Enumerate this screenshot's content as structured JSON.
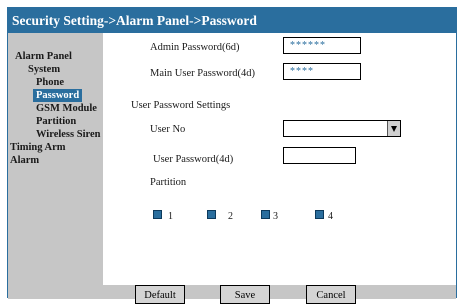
{
  "title": "Security Setting->Alarm Panel->Password",
  "sidebar": {
    "items": [
      {
        "label": "Alarm Panel"
      },
      {
        "label": "System"
      },
      {
        "label": "Phone"
      },
      {
        "label": "Password"
      },
      {
        "label": "GSM Module"
      },
      {
        "label": "Partition"
      },
      {
        "label": "Wireless Siren"
      },
      {
        "label": "Timing Arm"
      },
      {
        "label": "Alarm"
      }
    ],
    "selected": "Password"
  },
  "form": {
    "admin_password_label": "Admin Password(6d)",
    "admin_password_value": "******",
    "main_user_password_label": "Main User Password(4d)",
    "main_user_password_value": "****",
    "user_section_label": "User Password Settings",
    "user_no_label": "User No",
    "user_no_value": "",
    "user_password_label": "User Password(4d)",
    "user_password_value": "",
    "partition_label": "Partition",
    "partitions": [
      {
        "label": "1",
        "checked": true
      },
      {
        "label": "2",
        "checked": true
      },
      {
        "label": "3",
        "checked": true
      },
      {
        "label": "4",
        "checked": true
      }
    ]
  },
  "buttons": {
    "default_label": "Default",
    "save_label": "Save",
    "cancel_label": "Cancel"
  },
  "colors": {
    "accent": "#2a6e9e",
    "sidebar_bg": "#c6c6c6"
  }
}
